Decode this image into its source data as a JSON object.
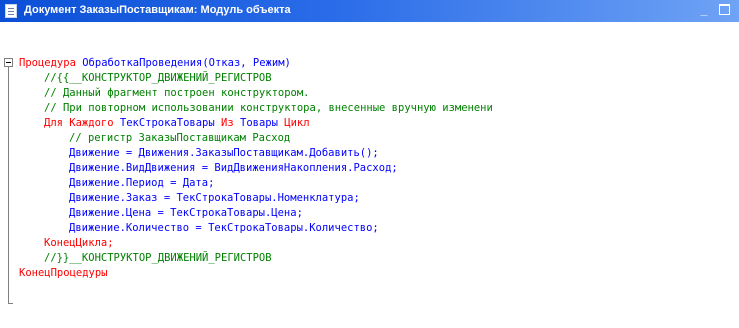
{
  "window": {
    "title": "Документ ЗаказыПоставщикам: Модуль объекта",
    "minimize_label": "_"
  },
  "code": {
    "lines": [
      {
        "tokens": [
          {
            "t": "Процедура",
            "c": "kw"
          },
          {
            "t": " ОбработкаПроведения(Отказ, Режим)",
            "c": "id"
          }
        ]
      },
      {
        "tokens": [
          {
            "t": "//{{__КОНСТРУКТОР_ДВИЖЕНИЙ_РЕГИСТРОВ",
            "c": "cm"
          }
        ]
      },
      {
        "tokens": [
          {
            "t": "// Данный фрагмент построен конструктором.",
            "c": "cm"
          }
        ]
      },
      {
        "tokens": [
          {
            "t": "// При повторном использовании конструктора, внесенные вручную изменени",
            "c": "cm"
          }
        ]
      },
      {
        "tokens": [
          {
            "t": "Для Каждого",
            "c": "kw"
          },
          {
            "t": " ТекСтрокаТовары ",
            "c": "id"
          },
          {
            "t": "Из",
            "c": "kw"
          },
          {
            "t": " Товары ",
            "c": "id"
          },
          {
            "t": "Цикл",
            "c": "kw"
          }
        ]
      },
      {
        "tokens": [
          {
            "t": "// регистр ЗаказыПоставщикам Расход",
            "c": "cm"
          }
        ]
      },
      {
        "tokens": [
          {
            "t": "Движение = Движения.ЗаказыПоставщикам.Добавить();",
            "c": "id"
          }
        ]
      },
      {
        "tokens": [
          {
            "t": "Движение.ВидДвижения = ВидДвиженияНакопления.Расход;",
            "c": "id"
          }
        ]
      },
      {
        "tokens": [
          {
            "t": "Движение.Период = Дата;",
            "c": "id"
          }
        ]
      },
      {
        "tokens": [
          {
            "t": "Движение.Заказ = ТекСтрокаТовары.Номенклатура;",
            "c": "id"
          }
        ]
      },
      {
        "tokens": [
          {
            "t": "Движение.Цена = ТекСтрокаТовары.Цена;",
            "c": "id"
          }
        ]
      },
      {
        "tokens": [
          {
            "t": "Движение.Количество = ТекСтрокаТовары.Количество;",
            "c": "id"
          }
        ]
      },
      {
        "tokens": [
          {
            "t": "КонецЦикла;",
            "c": "kw"
          }
        ]
      },
      {
        "tokens": [
          {
            "t": "//}}__КОНСТРУКТОР_ДВИЖЕНИЙ_РЕГИСТРОВ",
            "c": "cm"
          }
        ]
      },
      {
        "tokens": [
          {
            "t": "КонецПроцедуры",
            "c": "kw"
          }
        ]
      }
    ]
  }
}
